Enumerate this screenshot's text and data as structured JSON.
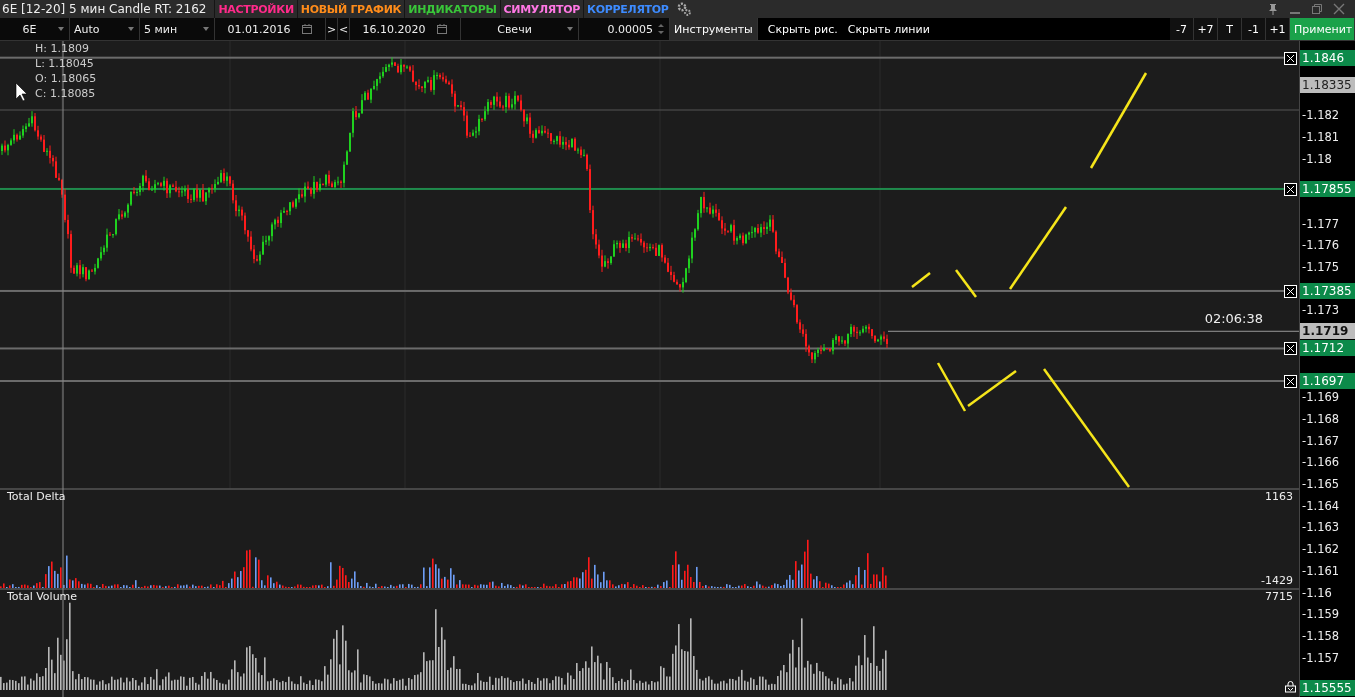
{
  "title_bar": {
    "title": "6E [12-20] 5 мин Candle RT: 2162",
    "menu": [
      {
        "label": "НАСТРОЙКИ",
        "color": "#ff2a8a"
      },
      {
        "label": "НОВЫЙ ГРАФИК",
        "color": "#ff8c1a"
      },
      {
        "label": "ИНДИКАТОРЫ",
        "color": "#39c639"
      },
      {
        "label": "СИМУЛЯТОР",
        "color": "#ff77e4"
      },
      {
        "label": "КОРРЕЛЯТОР",
        "color": "#3d8bff"
      }
    ]
  },
  "toolbar": {
    "symbol": "6E",
    "mode": "Auto",
    "timeframe": "5 мин",
    "date_from": "01.01.2016",
    "next": ">",
    "prev": "<",
    "date_to": "16.10.2020",
    "chart_type": "Свечи",
    "step": "0.00005",
    "tools": "Инструменты",
    "hide_drawings": "Скрыть рис.",
    "hide_lines": "Скрыть линии",
    "shift_buttons": [
      "-7",
      "+7",
      "T",
      "-1",
      "+1"
    ],
    "apply": "Применит"
  },
  "ohlc": [
    "H: 1.1809",
    "L: 1.18045",
    "O: 1.18065",
    "C: 1.18085"
  ],
  "timer": "02:06:38",
  "price_axis": [
    "-1.182",
    "-1.181",
    "-1.18",
    "-1.177",
    "-1.176",
    "-1.175",
    "-1.173",
    "-1.169",
    "-1.168",
    "-1.167",
    "-1.166",
    "-1.165",
    "-1.164",
    "-1.163",
    "-1.162",
    "-1.161",
    "-1.16",
    "-1.159",
    "-1.158",
    "-1.157"
  ],
  "price_tags": [
    {
      "kind": "level",
      "price": "1.1846",
      "color": "#6b6b6b"
    },
    {
      "kind": "marker",
      "price": "1.18335"
    },
    {
      "kind": "level",
      "price": "1.17855",
      "color": "#1f8a4c"
    },
    {
      "kind": "level",
      "price": "1.17385",
      "color": "#6b6b6b"
    },
    {
      "kind": "last",
      "price": "1.1719"
    },
    {
      "kind": "level",
      "price": "1.1712",
      "color": "#6b6b6b"
    },
    {
      "kind": "level",
      "price": "1.1697",
      "color": "#6b6b6b"
    },
    {
      "kind": "scale",
      "price": "1.15555"
    }
  ],
  "delta_panel": {
    "label": "Total Delta",
    "max": "1163",
    "min": "-1429"
  },
  "volume_panel": {
    "label": "Total Volume",
    "max": "7715"
  }
}
